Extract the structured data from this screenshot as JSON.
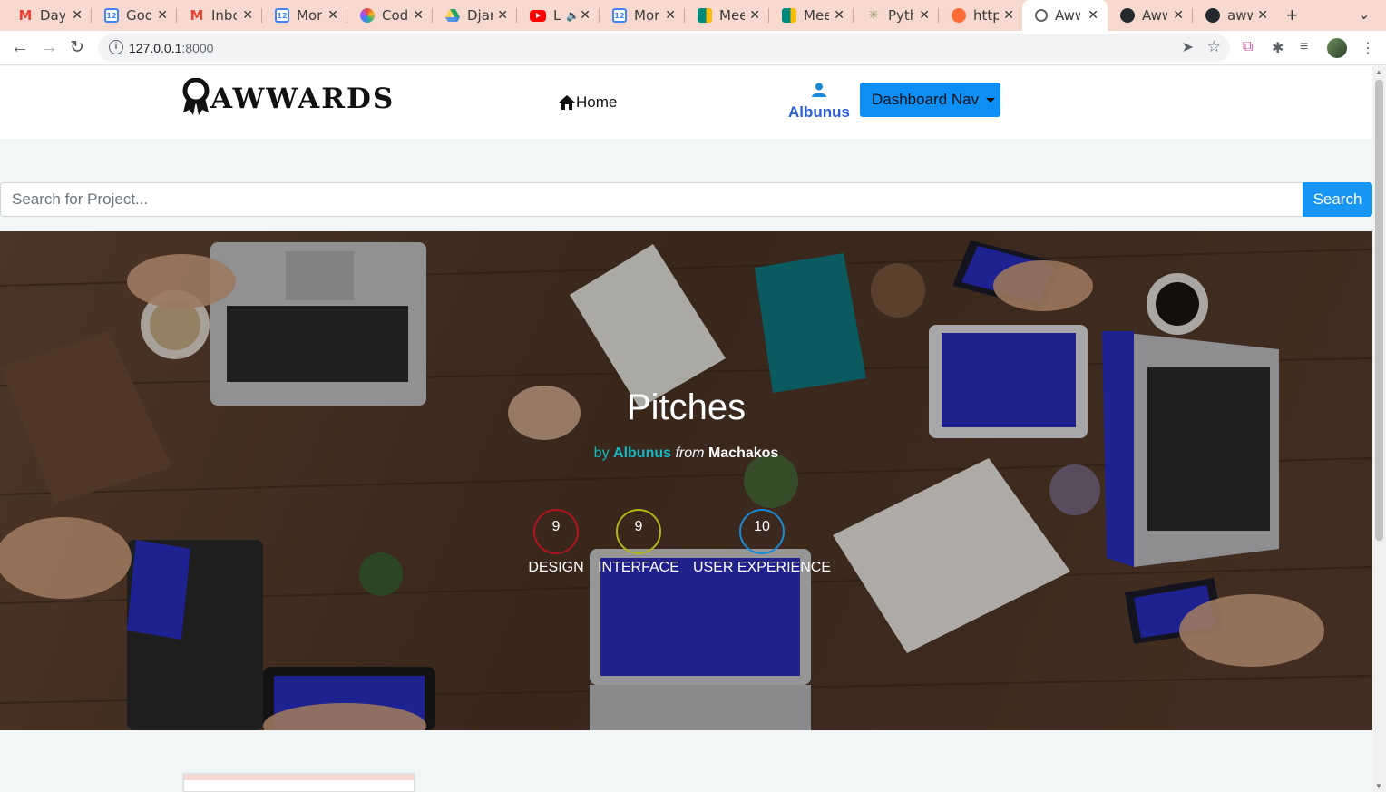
{
  "browser": {
    "tabs": [
      {
        "title": "Day",
        "icon": "gmail-icon",
        "color": "#ea4335"
      },
      {
        "title": "Goo",
        "icon": "calendar-icon",
        "color": "#4285f4"
      },
      {
        "title": "Inbo",
        "icon": "gmail-icon",
        "color": "#ea4335"
      },
      {
        "title": "Mor",
        "icon": "calendar-icon",
        "color": "#4285f4"
      },
      {
        "title": "Cod",
        "icon": "codewars-icon",
        "color": "#b94dd3"
      },
      {
        "title": "Djar",
        "icon": "drive-icon",
        "color": "#1fa463"
      },
      {
        "title": "L",
        "icon": "youtube-icon",
        "color": "#ff0000"
      },
      {
        "title": "Mor",
        "icon": "calendar-icon",
        "color": "#4285f4"
      },
      {
        "title": "Mee",
        "icon": "meet-icon",
        "color": "#00897b"
      },
      {
        "title": "Mee",
        "icon": "meet-icon",
        "color": "#00897b"
      },
      {
        "title": "Pyth",
        "icon": "palm-icon",
        "color": "#8d9a6a"
      },
      {
        "title": "http",
        "icon": "postman-icon",
        "color": "#ff6c37"
      },
      {
        "title": "Aww",
        "icon": "globe-icon",
        "color": "#5f6368"
      },
      {
        "title": "Aww",
        "icon": "github-icon",
        "color": "#24292e"
      },
      {
        "title": "aww",
        "icon": "github-icon",
        "color": "#24292e"
      }
    ],
    "url_host": "127.0.0.1",
    "url_port": ":8000"
  },
  "nav": {
    "logo_text": "AWWARDS",
    "home_label": "Home",
    "user_name": "Albunus",
    "dashboard_label": "Dashboard Nav"
  },
  "search": {
    "placeholder": "Search for Project...",
    "button_label": "Search"
  },
  "project": {
    "title": "Pitches",
    "by_label": "by",
    "author": "Albunus",
    "from_label": "from",
    "location": "Machakos",
    "scores": [
      {
        "value": "9",
        "label": "DESIGN",
        "color": "#b0141c"
      },
      {
        "value": "9",
        "label": "INTERFACE",
        "color": "#b5b517"
      },
      {
        "value": "10",
        "label": "USER EXPERIENCE",
        "color": "#1a8ad8"
      }
    ]
  },
  "colors": {
    "accent": "#0d8ff5",
    "author": "#17b8c6",
    "username": "#2b5fd9"
  }
}
